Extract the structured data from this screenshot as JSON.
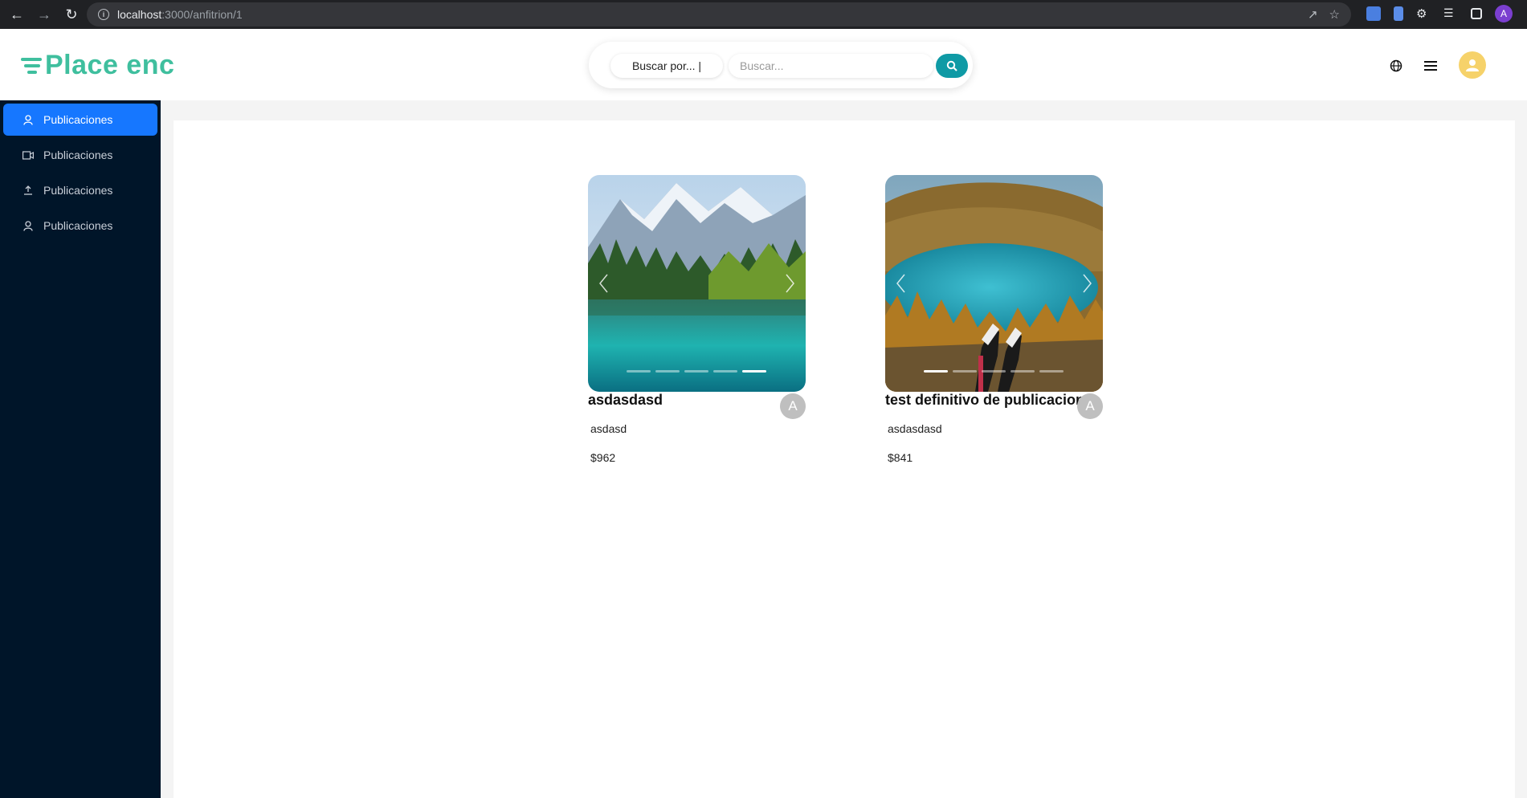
{
  "browser": {
    "url_host": "localhost",
    "url_path": ":3000/anfitrion/1",
    "profile_initial": "A"
  },
  "header": {
    "logo_text": "Place enc",
    "search": {
      "filter_label": "Buscar por... |",
      "placeholder": "Buscar...",
      "button_icon": "search-icon"
    },
    "icons": [
      "globe-icon",
      "menu-icon",
      "user-avatar-icon"
    ],
    "brand_color": "#3fbf9e",
    "accent_color": "#0f9aa5"
  },
  "sidebar": {
    "items": [
      {
        "label": "Publicaciones",
        "icon": "user-icon",
        "active": true
      },
      {
        "label": "Publicaciones",
        "icon": "video-icon",
        "active": false
      },
      {
        "label": "Publicaciones",
        "icon": "upload-icon",
        "active": false
      },
      {
        "label": "Publicaciones",
        "icon": "user-icon",
        "active": false
      }
    ],
    "active_color": "#1677ff"
  },
  "listings": [
    {
      "title": "asdasdasd",
      "description": "asdasd",
      "price": "$962",
      "owner_initial": "A",
      "image_count": 5,
      "active_slide": 5
    },
    {
      "title": "test definitivo de publicacion",
      "description": "asdasdasd",
      "price": "$841",
      "owner_initial": "A",
      "image_count": 5,
      "active_slide": 1
    }
  ]
}
